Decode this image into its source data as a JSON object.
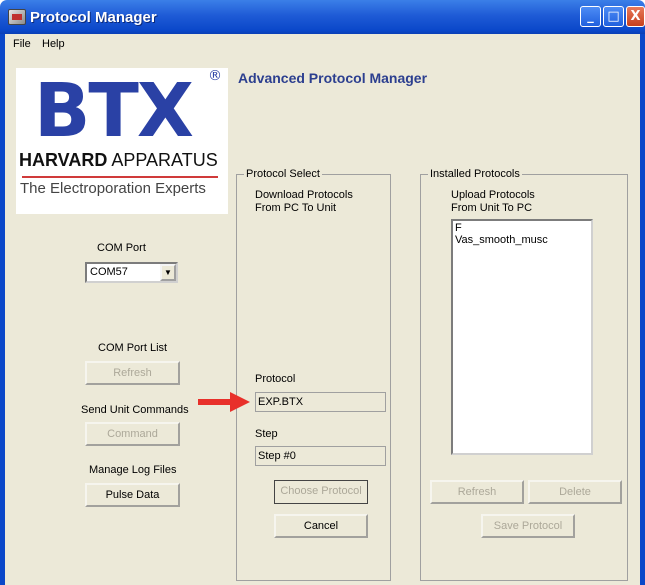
{
  "window": {
    "title": "Protocol Manager",
    "controls": {
      "minimize": "_",
      "maximize": "□",
      "close": "X"
    }
  },
  "menu": {
    "file": "File",
    "help": "Help"
  },
  "logo": {
    "wordmark": "BTX",
    "registered": "®",
    "company_bold": "HARVARD",
    "company_rest": " APPARATUS",
    "tagline": "The Electroporation Experts"
  },
  "heading": "Advanced Protocol Manager",
  "left_panel": {
    "com_port_label": "COM Port",
    "com_port_value": "COM57",
    "com_port_list_label": "COM Port List",
    "refresh_button": "Refresh",
    "send_commands_label": "Send Unit Commands",
    "command_button": "Command",
    "log_files_label": "Manage Log Files",
    "pulse_data_button": "Pulse Data"
  },
  "protocol_select": {
    "title": "Protocol Select",
    "description_line1": "Download Protocols",
    "description_line2": "From PC To Unit",
    "protocol_label": "Protocol",
    "protocol_value": "EXP.BTX",
    "step_label": "Step",
    "step_value": "Step #0",
    "choose_button": "Choose Protocol",
    "cancel_button": "Cancel"
  },
  "installed_protocols": {
    "title": "Installed Protocols",
    "description_line1": "Upload Protocols",
    "description_line2": "From Unit To PC",
    "items": [
      "F",
      "Vas_smooth_musc"
    ],
    "refresh_button": "Refresh",
    "delete_button": "Delete",
    "save_button": "Save Protocol"
  },
  "colors": {
    "titlebar": "#0a47c9",
    "face": "#ece9d8",
    "logo_blue": "#2a41a5",
    "heading": "#2c3f8f",
    "arrow": "#e8302a",
    "disabled_text": "#aca899"
  }
}
